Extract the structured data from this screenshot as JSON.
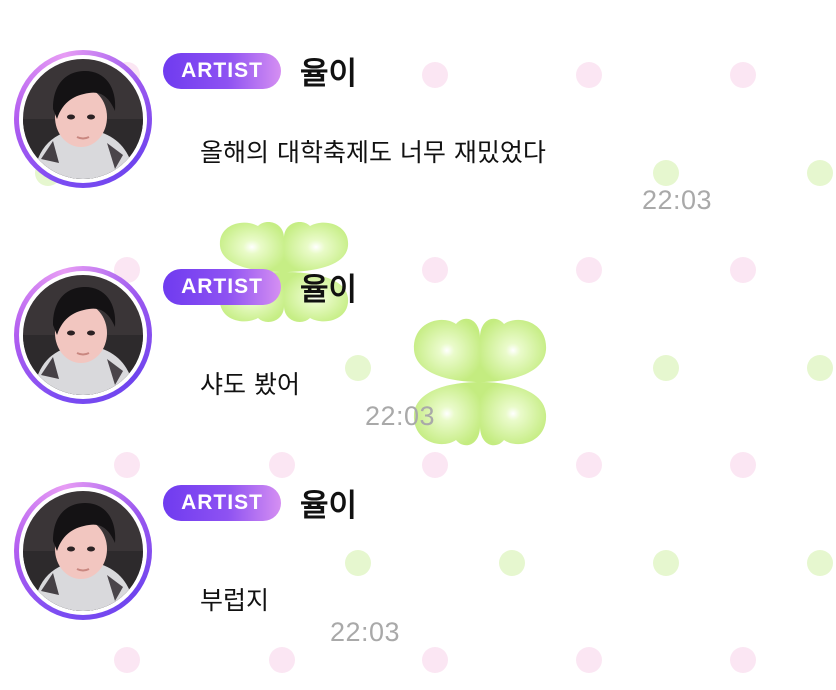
{
  "colors": {
    "badge_start": "#6f3bf0",
    "badge_end": "#d58ff2",
    "dot_pink": "#fbe6f3",
    "dot_green": "#e6f7cf",
    "clover_green": "#c9f08a",
    "time_gray": "#a9a9a9"
  },
  "messages": [
    {
      "badge": "ARTIST",
      "sender": "율이",
      "text": "올해의 대학축제도 너무 재밌었다",
      "time": "22:03",
      "avatar_icon": "profile-photo"
    },
    {
      "badge": "ARTIST",
      "sender": "율이",
      "text": "샤도 봤어",
      "time": "22:03",
      "avatar_icon": "profile-photo"
    },
    {
      "badge": "ARTIST",
      "sender": "율이",
      "text": "부럽지",
      "time": "22:03",
      "avatar_icon": "profile-photo"
    }
  ]
}
